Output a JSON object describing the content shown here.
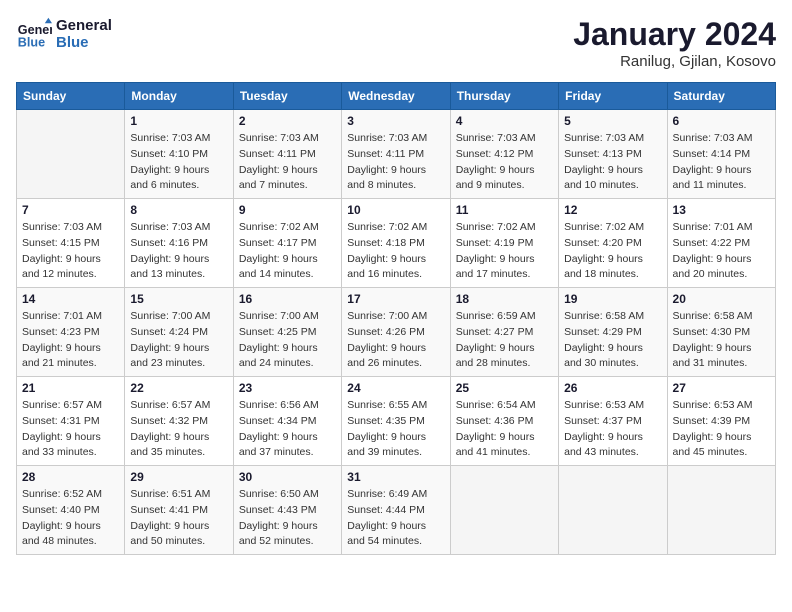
{
  "logo": {
    "line1": "General",
    "line2": "Blue"
  },
  "title": "January 2024",
  "subtitle": "Ranilug, Gjilan, Kosovo",
  "weekdays": [
    "Sunday",
    "Monday",
    "Tuesday",
    "Wednesday",
    "Thursday",
    "Friday",
    "Saturday"
  ],
  "weeks": [
    [
      {
        "day": "",
        "info": []
      },
      {
        "day": "1",
        "info": [
          "Sunrise: 7:03 AM",
          "Sunset: 4:10 PM",
          "Daylight: 9 hours",
          "and 6 minutes."
        ]
      },
      {
        "day": "2",
        "info": [
          "Sunrise: 7:03 AM",
          "Sunset: 4:11 PM",
          "Daylight: 9 hours",
          "and 7 minutes."
        ]
      },
      {
        "day": "3",
        "info": [
          "Sunrise: 7:03 AM",
          "Sunset: 4:11 PM",
          "Daylight: 9 hours",
          "and 8 minutes."
        ]
      },
      {
        "day": "4",
        "info": [
          "Sunrise: 7:03 AM",
          "Sunset: 4:12 PM",
          "Daylight: 9 hours",
          "and 9 minutes."
        ]
      },
      {
        "day": "5",
        "info": [
          "Sunrise: 7:03 AM",
          "Sunset: 4:13 PM",
          "Daylight: 9 hours",
          "and 10 minutes."
        ]
      },
      {
        "day": "6",
        "info": [
          "Sunrise: 7:03 AM",
          "Sunset: 4:14 PM",
          "Daylight: 9 hours",
          "and 11 minutes."
        ]
      }
    ],
    [
      {
        "day": "7",
        "info": [
          "Sunrise: 7:03 AM",
          "Sunset: 4:15 PM",
          "Daylight: 9 hours",
          "and 12 minutes."
        ]
      },
      {
        "day": "8",
        "info": [
          "Sunrise: 7:03 AM",
          "Sunset: 4:16 PM",
          "Daylight: 9 hours",
          "and 13 minutes."
        ]
      },
      {
        "day": "9",
        "info": [
          "Sunrise: 7:02 AM",
          "Sunset: 4:17 PM",
          "Daylight: 9 hours",
          "and 14 minutes."
        ]
      },
      {
        "day": "10",
        "info": [
          "Sunrise: 7:02 AM",
          "Sunset: 4:18 PM",
          "Daylight: 9 hours",
          "and 16 minutes."
        ]
      },
      {
        "day": "11",
        "info": [
          "Sunrise: 7:02 AM",
          "Sunset: 4:19 PM",
          "Daylight: 9 hours",
          "and 17 minutes."
        ]
      },
      {
        "day": "12",
        "info": [
          "Sunrise: 7:02 AM",
          "Sunset: 4:20 PM",
          "Daylight: 9 hours",
          "and 18 minutes."
        ]
      },
      {
        "day": "13",
        "info": [
          "Sunrise: 7:01 AM",
          "Sunset: 4:22 PM",
          "Daylight: 9 hours",
          "and 20 minutes."
        ]
      }
    ],
    [
      {
        "day": "14",
        "info": [
          "Sunrise: 7:01 AM",
          "Sunset: 4:23 PM",
          "Daylight: 9 hours",
          "and 21 minutes."
        ]
      },
      {
        "day": "15",
        "info": [
          "Sunrise: 7:00 AM",
          "Sunset: 4:24 PM",
          "Daylight: 9 hours",
          "and 23 minutes."
        ]
      },
      {
        "day": "16",
        "info": [
          "Sunrise: 7:00 AM",
          "Sunset: 4:25 PM",
          "Daylight: 9 hours",
          "and 24 minutes."
        ]
      },
      {
        "day": "17",
        "info": [
          "Sunrise: 7:00 AM",
          "Sunset: 4:26 PM",
          "Daylight: 9 hours",
          "and 26 minutes."
        ]
      },
      {
        "day": "18",
        "info": [
          "Sunrise: 6:59 AM",
          "Sunset: 4:27 PM",
          "Daylight: 9 hours",
          "and 28 minutes."
        ]
      },
      {
        "day": "19",
        "info": [
          "Sunrise: 6:58 AM",
          "Sunset: 4:29 PM",
          "Daylight: 9 hours",
          "and 30 minutes."
        ]
      },
      {
        "day": "20",
        "info": [
          "Sunrise: 6:58 AM",
          "Sunset: 4:30 PM",
          "Daylight: 9 hours",
          "and 31 minutes."
        ]
      }
    ],
    [
      {
        "day": "21",
        "info": [
          "Sunrise: 6:57 AM",
          "Sunset: 4:31 PM",
          "Daylight: 9 hours",
          "and 33 minutes."
        ]
      },
      {
        "day": "22",
        "info": [
          "Sunrise: 6:57 AM",
          "Sunset: 4:32 PM",
          "Daylight: 9 hours",
          "and 35 minutes."
        ]
      },
      {
        "day": "23",
        "info": [
          "Sunrise: 6:56 AM",
          "Sunset: 4:34 PM",
          "Daylight: 9 hours",
          "and 37 minutes."
        ]
      },
      {
        "day": "24",
        "info": [
          "Sunrise: 6:55 AM",
          "Sunset: 4:35 PM",
          "Daylight: 9 hours",
          "and 39 minutes."
        ]
      },
      {
        "day": "25",
        "info": [
          "Sunrise: 6:54 AM",
          "Sunset: 4:36 PM",
          "Daylight: 9 hours",
          "and 41 minutes."
        ]
      },
      {
        "day": "26",
        "info": [
          "Sunrise: 6:53 AM",
          "Sunset: 4:37 PM",
          "Daylight: 9 hours",
          "and 43 minutes."
        ]
      },
      {
        "day": "27",
        "info": [
          "Sunrise: 6:53 AM",
          "Sunset: 4:39 PM",
          "Daylight: 9 hours",
          "and 45 minutes."
        ]
      }
    ],
    [
      {
        "day": "28",
        "info": [
          "Sunrise: 6:52 AM",
          "Sunset: 4:40 PM",
          "Daylight: 9 hours",
          "and 48 minutes."
        ]
      },
      {
        "day": "29",
        "info": [
          "Sunrise: 6:51 AM",
          "Sunset: 4:41 PM",
          "Daylight: 9 hours",
          "and 50 minutes."
        ]
      },
      {
        "day": "30",
        "info": [
          "Sunrise: 6:50 AM",
          "Sunset: 4:43 PM",
          "Daylight: 9 hours",
          "and 52 minutes."
        ]
      },
      {
        "day": "31",
        "info": [
          "Sunrise: 6:49 AM",
          "Sunset: 4:44 PM",
          "Daylight: 9 hours",
          "and 54 minutes."
        ]
      },
      {
        "day": "",
        "info": []
      },
      {
        "day": "",
        "info": []
      },
      {
        "day": "",
        "info": []
      }
    ]
  ]
}
